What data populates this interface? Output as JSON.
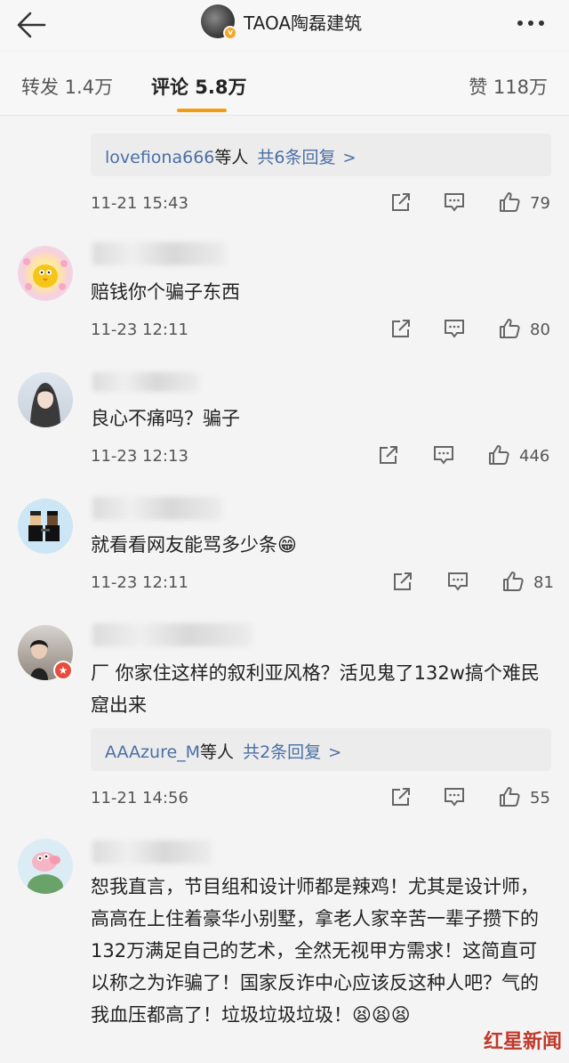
{
  "header": {
    "back_label": "back",
    "account_name": "TAOA陶磊建筑",
    "verified_mark": "v"
  },
  "tabs": {
    "reposts": "转发 1.4万",
    "comments": "评论 5.8万",
    "likes": "赞 118万"
  },
  "top_block": {
    "reply_user": "lovefiona666",
    "reply_etc": "等人",
    "reply_count": "共6条回复",
    "reply_chevron": ">",
    "time": "11-21 15:43",
    "likes": "79"
  },
  "comments": [
    {
      "text": "赔钱你个骗子东西",
      "time": "11-23 12:11",
      "likes": "80"
    },
    {
      "text": "良心不痛吗？骗子",
      "time": "11-23 12:13",
      "likes": "446"
    },
    {
      "text": "就看看网友能骂多少条😁",
      "time": "11-23 12:11",
      "likes": "81"
    },
    {
      "text": "厂  你家住这样的叙利亚风格？活见鬼了132w搞个难民窟出来",
      "time": "11-21 14:56",
      "likes": "55",
      "reply_user": "AAAzure_M",
      "reply_etc": "等人",
      "reply_count": "共2条回复",
      "reply_chevron": ">"
    },
    {
      "text": "恕我直言，节目组和设计师都是辣鸡！尤其是设计师，高高在上住着豪华小别墅，拿老人家辛苦一辈子攒下的132万满足自己的艺术，全然无视甲方需求！这简直可以称之为诈骗了！国家反诈中心应该反这种人吧？气的我血压都高了！垃圾垃圾垃圾！😫😫😫"
    }
  ],
  "watermark": "红星新闻",
  "colors": {
    "accent": "#f39c12",
    "link": "#4a6fa5",
    "background": "#f4f4f4"
  }
}
